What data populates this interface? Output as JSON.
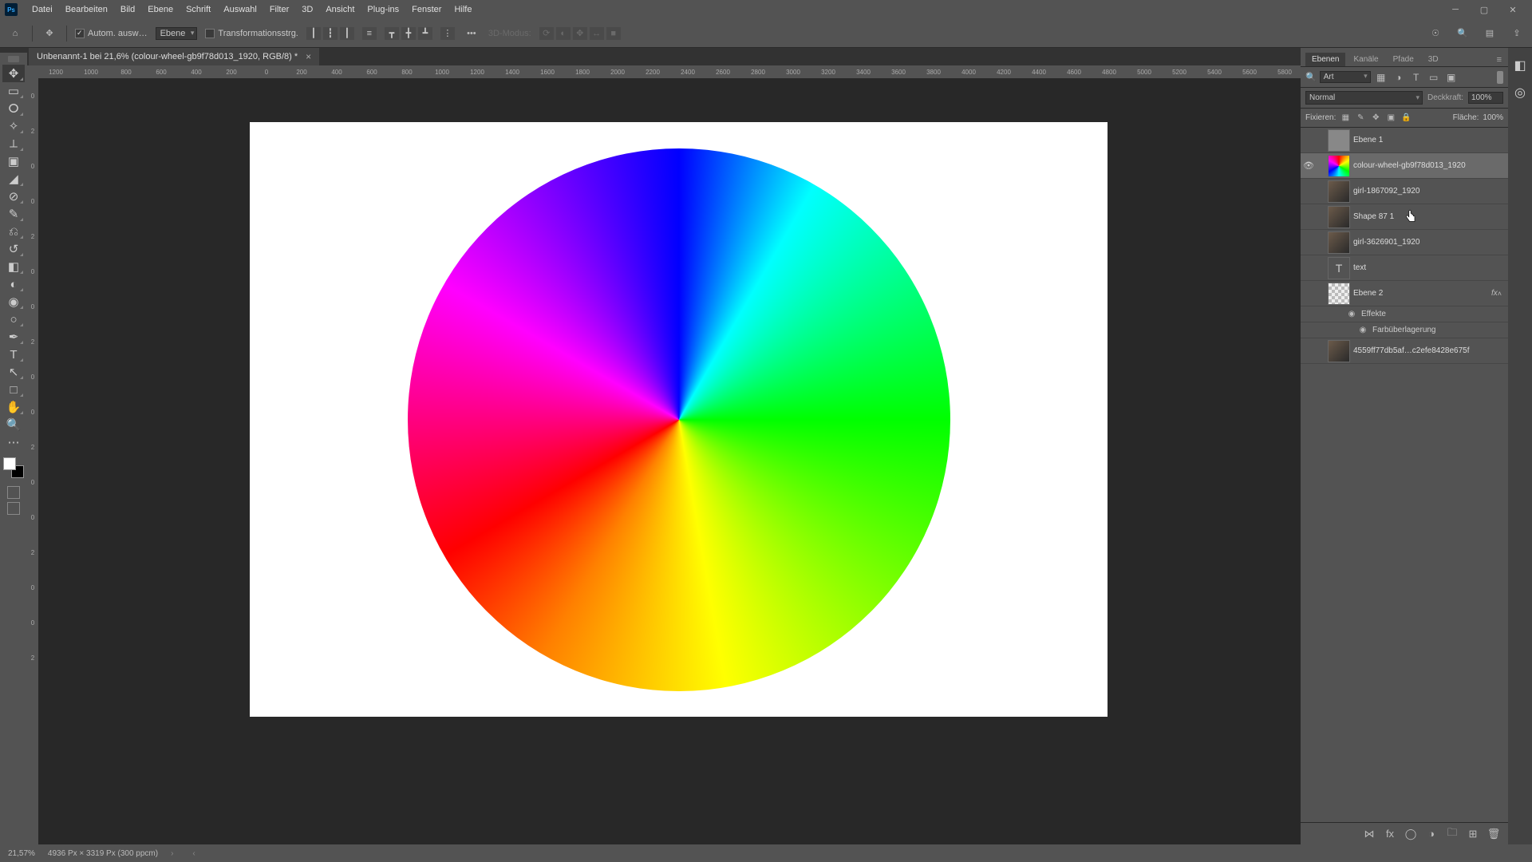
{
  "menu": [
    "Datei",
    "Bearbeiten",
    "Bild",
    "Ebene",
    "Schrift",
    "Auswahl",
    "Filter",
    "3D",
    "Ansicht",
    "Plug-ins",
    "Fenster",
    "Hilfe"
  ],
  "options": {
    "auto_select_label": "Autom. ausw…",
    "layer_dropdown": "Ebene",
    "transform_label": "Transformationsstrg.",
    "threeD_label": "3D-Modus:"
  },
  "doc_tab": "Unbenannt-1 bei 21,6% (colour-wheel-gb9f78d013_1920, RGB/8) *",
  "rulers_h": [
    "1200",
    "1000",
    "800",
    "600",
    "400",
    "200",
    "0",
    "200",
    "400",
    "600",
    "800",
    "1000",
    "1200",
    "1400",
    "1600",
    "1800",
    "2000",
    "2200",
    "2400",
    "2600",
    "2800",
    "3000",
    "3200",
    "3400",
    "3600",
    "3800",
    "4000",
    "4200",
    "4400",
    "4600",
    "4800",
    "5000",
    "5200",
    "5400",
    "5600",
    "5800"
  ],
  "rulers_v": [
    "0",
    "2",
    "0",
    "0",
    "2",
    "0",
    "0",
    "2",
    "0",
    "0",
    "2",
    "0",
    "0",
    "2",
    "0",
    "0",
    "2"
  ],
  "panel": {
    "tabs": [
      "Ebenen",
      "Kanäle",
      "Pfade",
      "3D"
    ],
    "filter_label": "Art",
    "blend_mode": "Normal",
    "opacity_label": "Deckkraft:",
    "opacity_value": "100%",
    "lock_label": "Fixieren:",
    "fill_label": "Fläche:",
    "fill_value": "100%",
    "fx_label": "fx",
    "effects_label": "Effekte",
    "color_overlay_label": "Farbüberlagerung"
  },
  "layers": [
    {
      "name": "Ebene 1",
      "visible": false,
      "thumb": "plain"
    },
    {
      "name": "colour-wheel-gb9f78d013_1920",
      "visible": true,
      "selected": true,
      "thumb": "wheel"
    },
    {
      "name": "girl-1867092_1920",
      "visible": false,
      "thumb": "photo"
    },
    {
      "name": "Shape 87 1",
      "visible": false,
      "thumb": "shape"
    },
    {
      "name": "girl-3626901_1920",
      "visible": false,
      "thumb": "photo"
    },
    {
      "name": "text",
      "visible": false,
      "thumb": "T",
      "istext": true
    },
    {
      "name": "Ebene 2",
      "visible": false,
      "thumb": "checker",
      "fx": true
    },
    {
      "name": "4559ff77db5af…c2efe8428e675f",
      "visible": false,
      "thumb": "photo"
    }
  ],
  "status": {
    "zoom": "21,57%",
    "info": "4936 Px × 3319 Px (300 ppcm)"
  }
}
